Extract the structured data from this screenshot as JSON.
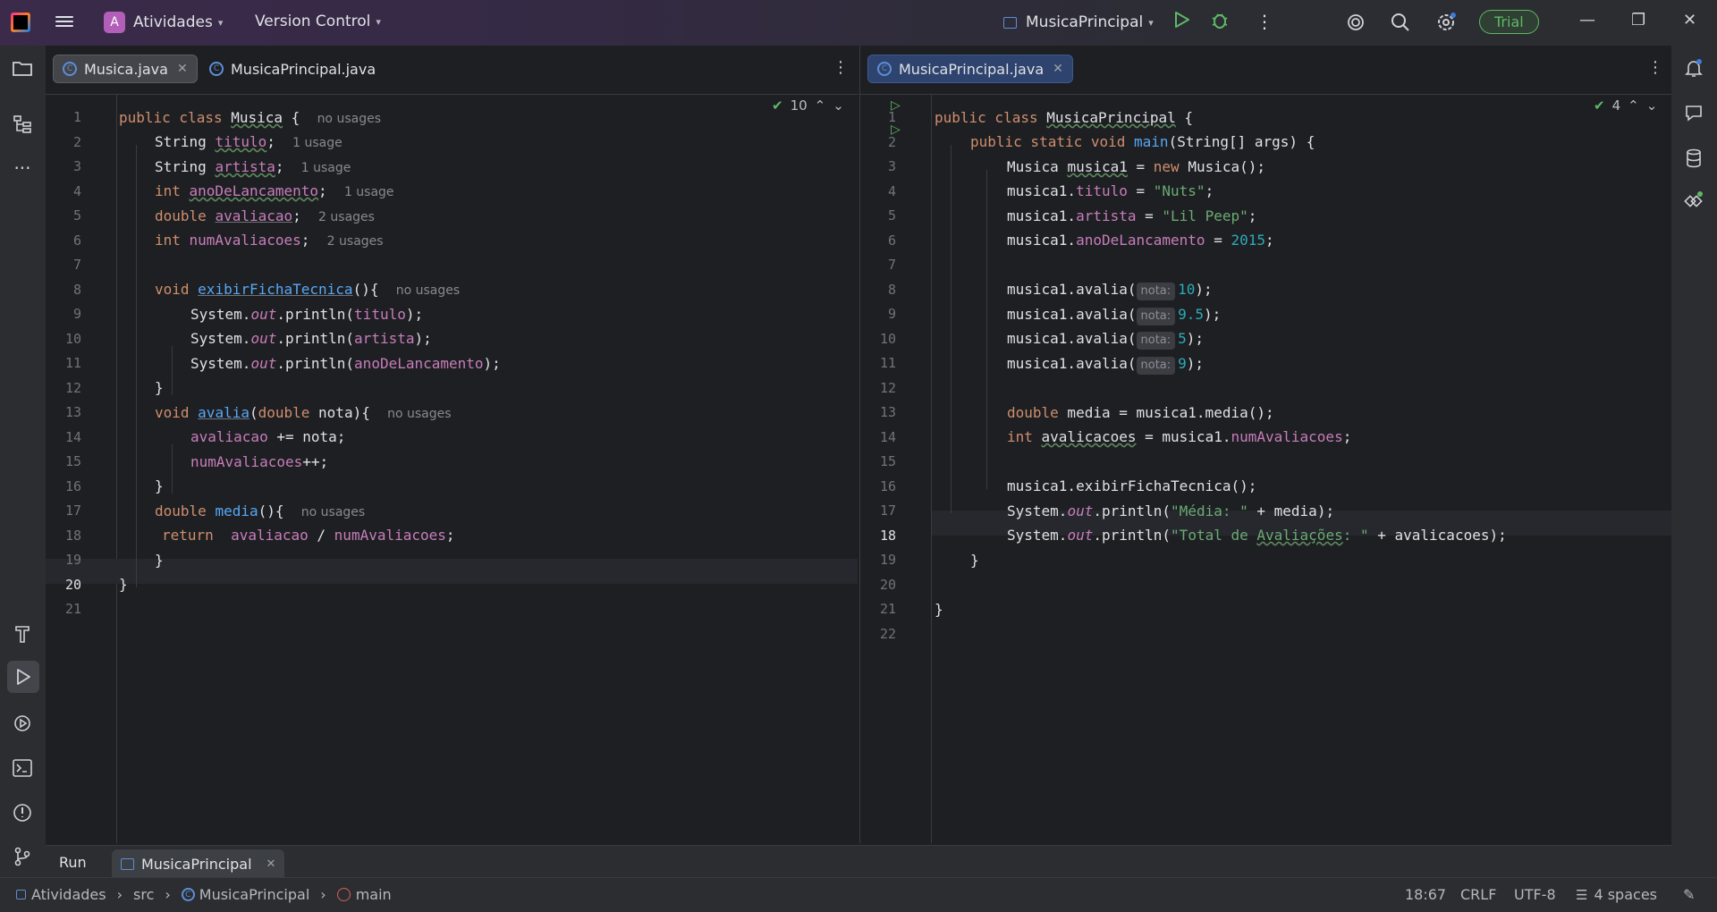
{
  "titlebar": {
    "project_initial": "A",
    "project_name": "Atividades",
    "vcs_label": "Version Control",
    "run_config": "MusicaPrincipal",
    "trial_label": "Trial"
  },
  "left_editor": {
    "tabs": [
      {
        "label": "Musica.java",
        "active": true
      },
      {
        "label": "MusicaPrincipal.java",
        "active": false
      }
    ],
    "inspection_count": "10",
    "line_numbers": [
      "1",
      "2",
      "3",
      "4",
      "5",
      "6",
      "7",
      "8",
      "9",
      "10",
      "11",
      "12",
      "13",
      "14",
      "15",
      "16",
      "17",
      "18",
      "19",
      "20",
      "21"
    ],
    "current_line": "20",
    "code": {
      "l1": [
        "public class ",
        "Musica",
        " {",
        "no usages"
      ],
      "l2": [
        "String ",
        "titulo",
        ";",
        "1 usage"
      ],
      "l3": [
        "String ",
        "artista",
        ";",
        "1 usage"
      ],
      "l4": [
        "int ",
        "anoDeLancamento",
        ";",
        "1 usage"
      ],
      "l5": [
        "double ",
        "avaliacao",
        ";",
        "2 usages"
      ],
      "l6": [
        "int ",
        "numAvaliacoes",
        ";",
        "2 usages"
      ],
      "l8": [
        "void ",
        "exibirFichaTecnica",
        "(){",
        "no usages"
      ],
      "l9": [
        "System.",
        "out",
        ".println(",
        "titulo",
        ");"
      ],
      "l10": [
        "System.",
        "out",
        ".println(",
        "artista",
        ");"
      ],
      "l11": [
        "System.",
        "out",
        ".println(",
        "anoDeLancamento",
        ");"
      ],
      "l12": "}",
      "l13": [
        "void ",
        "avalia",
        "(",
        "double",
        " nota){",
        "no usages"
      ],
      "l14": [
        "avaliacao",
        " += nota;"
      ],
      "l15": [
        "numAvaliacoes",
        "++;"
      ],
      "l16": "}",
      "l17": [
        "double ",
        "media",
        "(){",
        "no usages"
      ],
      "l18": [
        "return",
        "avaliacao",
        " / ",
        "numAvaliacoes",
        ";"
      ],
      "l19": "}",
      "l20": "}"
    }
  },
  "right_editor": {
    "tabs": [
      {
        "label": "MusicaPrincipal.java",
        "active": true
      }
    ],
    "inspection_count": "4",
    "line_numbers": [
      "1",
      "2",
      "3",
      "4",
      "5",
      "6",
      "7",
      "8",
      "9",
      "10",
      "11",
      "12",
      "13",
      "14",
      "15",
      "16",
      "17",
      "18",
      "19",
      "20",
      "21",
      "22"
    ],
    "current_line": "18",
    "code": {
      "l1": [
        "public class ",
        "MusicaPrincipal",
        " {"
      ],
      "l2": [
        "public static void ",
        "main",
        "(String[] args) {"
      ],
      "l3": [
        "Musica ",
        "musica1",
        " = ",
        "new",
        " Musica();"
      ],
      "l4": [
        "musica1.",
        "titulo",
        " = ",
        "\"Nuts\"",
        ";"
      ],
      "l5": [
        "musica1.",
        "artista",
        " = ",
        "\"Lil Peep\"",
        ";"
      ],
      "l6": [
        "musica1.",
        "anoDeLancamento",
        " = ",
        "2015",
        ";"
      ],
      "l8": [
        "musica1.avalia(",
        "nota:",
        "10",
        ");"
      ],
      "l9": [
        "musica1.avalia(",
        "nota:",
        "9.5",
        ");"
      ],
      "l10": [
        "musica1.avalia(",
        "nota:",
        "5",
        ");"
      ],
      "l11": [
        "musica1.avalia(",
        "nota:",
        "9",
        ");"
      ],
      "l13": [
        "double",
        " media = musica1.media();"
      ],
      "l14": [
        "int ",
        "avalicacoes",
        " = musica1.",
        "numAvaliacoes",
        ";"
      ],
      "l16": "musica1.exibirFichaTecnica();",
      "l17": [
        "System.",
        "out",
        ".println(",
        "\"Média: \"",
        " + media);"
      ],
      "l18": [
        "System.",
        "out",
        ".println(",
        "\"Total de ",
        "Avaliações",
        ": \"",
        " + avalicacoes);"
      ],
      "l19": "}",
      "l21": "}"
    }
  },
  "bottom_panel": {
    "tab_run": "Run",
    "run_config_tab": "MusicaPrincipal"
  },
  "statusbar": {
    "breadcrumbs": [
      "Atividades",
      "src",
      "MusicaPrincipal",
      "main"
    ],
    "position": "18:67",
    "line_separator": "CRLF",
    "encoding": "UTF-8",
    "indent": "4 spaces"
  },
  "colors": {
    "keyword": "#cf8e6d",
    "field": "#c77dbb",
    "method": "#56a8f5",
    "string": "#6aab73",
    "number": "#2aacb8",
    "accent_green": "#5fb866"
  }
}
